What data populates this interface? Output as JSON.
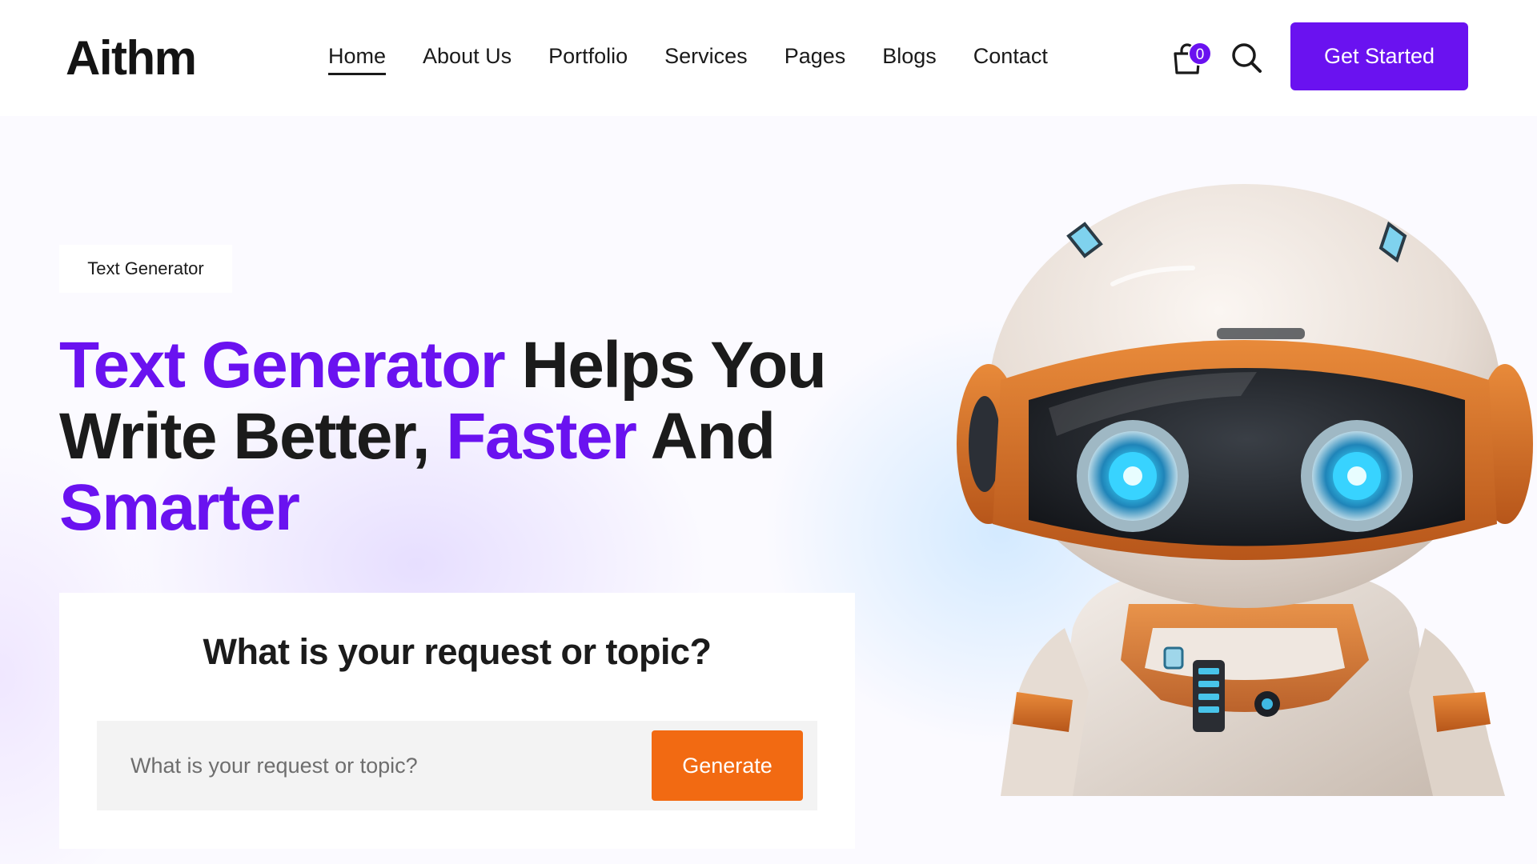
{
  "brand": {
    "name": "Aithm"
  },
  "nav": {
    "items": [
      {
        "label": "Home",
        "active": true
      },
      {
        "label": "About Us"
      },
      {
        "label": "Portfolio"
      },
      {
        "label": "Services"
      },
      {
        "label": "Pages"
      },
      {
        "label": "Blogs"
      },
      {
        "label": "Contact"
      }
    ]
  },
  "header": {
    "cart_count": "0",
    "cta_label": "Get Started",
    "icons": [
      "shopping-bag-icon",
      "search-icon"
    ]
  },
  "hero": {
    "tag": "Text Generator",
    "headline": {
      "part1": "Text Generator",
      "part2": " Helps You Write Better, ",
      "part3": "Faster",
      "part4": " And ",
      "part5": "Smarter"
    },
    "illustration": "robot-illustration"
  },
  "form": {
    "title": "What is your request or topic?",
    "placeholder": "What is your request or topic?",
    "button_label": "Generate"
  },
  "colors": {
    "accent": "#6a12f0",
    "button_orange": "#f26a12",
    "text": "#1b1b1b",
    "input_bg": "#f3f3f3"
  }
}
